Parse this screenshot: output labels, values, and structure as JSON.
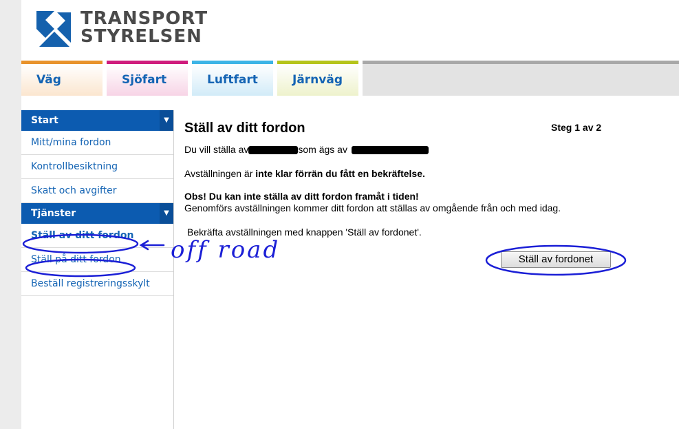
{
  "brand": {
    "logo_line1": "TRANSPORT",
    "logo_line2": "STYRELSEN",
    "logo_color": "#1561ad"
  },
  "tabs": [
    {
      "label": "Väg",
      "color": "#e8922a"
    },
    {
      "label": "Sjöfart",
      "color": "#cf1b7c"
    },
    {
      "label": "Luftfart",
      "color": "#3db4e6"
    },
    {
      "label": "Järnväg",
      "color": "#b5c41a"
    }
  ],
  "sidebar": {
    "sections": [
      {
        "heading": "Start",
        "items": [
          "Mitt/mina fordon",
          "Kontrollbesiktning",
          "Skatt och avgifter"
        ]
      },
      {
        "heading": "Tjänster",
        "items": [
          "Ställ av ditt fordon",
          "Ställ på ditt fordon",
          "Beställ registreringsskylt"
        ]
      }
    ],
    "chevron_icon": "chevron-down-icon"
  },
  "main": {
    "title": "Ställ av ditt fordon",
    "step": "Steg 1 av 2",
    "line1_a": "Du vill ställa av",
    "line1_b": "som ägs av",
    "line2_a": "Avställningen är ",
    "line2_b": "inte klar förrän du fått en bekräftelse.",
    "obs": "Obs! Du kan inte ställa av ditt fordon framåt i tiden!",
    "info": "Genomförs avställningen kommer ditt fordon att ställas av omgående från och med idag.",
    "confirm_text": "Bekräfta avställningen med knappen 'Ställ av fordonet'.",
    "button_label": "Ställ av fordonet"
  },
  "annotation": {
    "text": "off road",
    "color": "#1b1fd6"
  }
}
